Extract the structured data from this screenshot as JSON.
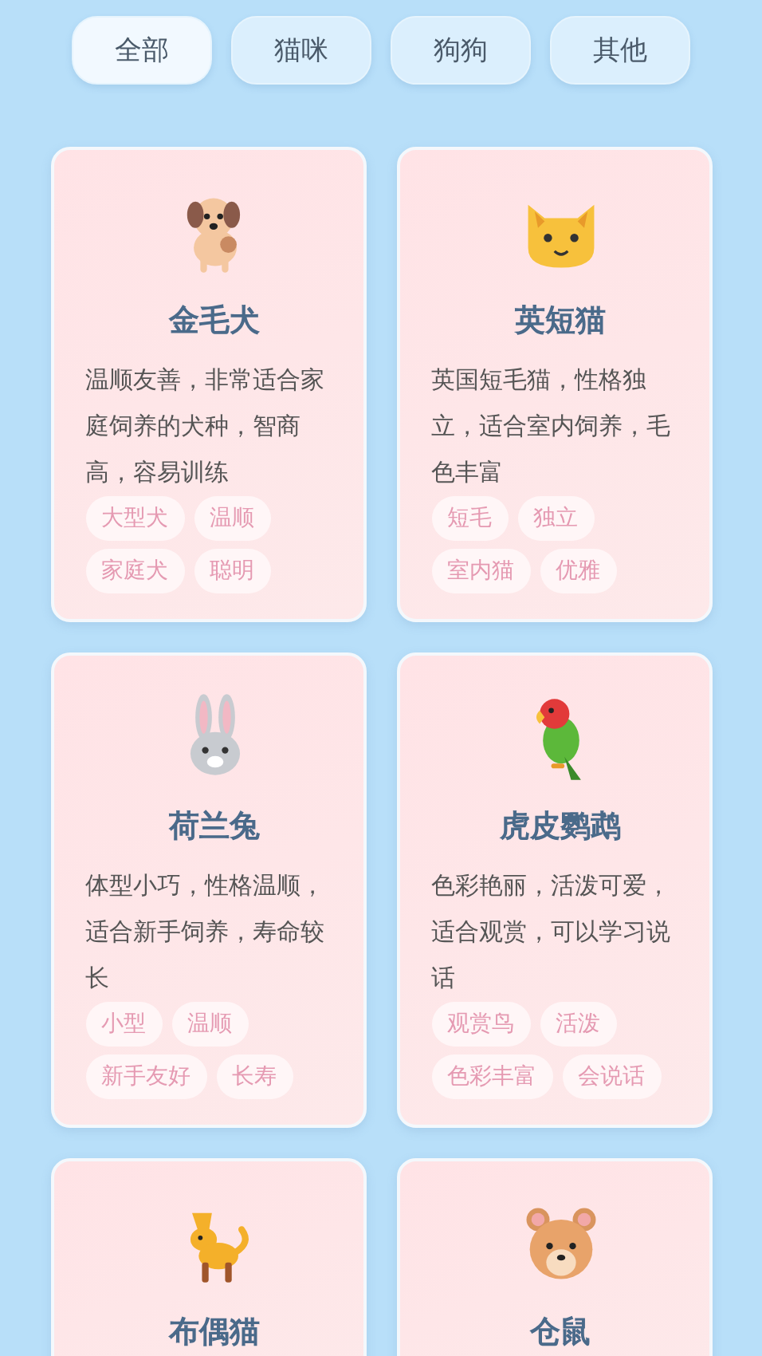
{
  "tabs": [
    {
      "label": "全部",
      "selected": true
    },
    {
      "label": "猫咪",
      "selected": false
    },
    {
      "label": "狗狗",
      "selected": false
    },
    {
      "label": "其他",
      "selected": false
    }
  ],
  "pets": [
    {
      "name": "金毛犬",
      "description": "温顺友善，非常适合家庭饲养的犬种，智商高，容易训练",
      "tags": [
        "大型犬",
        "温顺",
        "家庭犬",
        "聪明"
      ]
    },
    {
      "name": "英短猫",
      "description": "英国短毛猫，性格独立，适合室内饲养，毛色丰富",
      "tags": [
        "短毛",
        "独立",
        "室内猫",
        "优雅"
      ]
    },
    {
      "name": "荷兰兔",
      "description": "体型小巧，性格温顺，适合新手饲养，寿命较长",
      "tags": [
        "小型",
        "温顺",
        "新手友好",
        "长寿"
      ]
    },
    {
      "name": "虎皮鹦鹉",
      "description": "色彩艳丽，活泼可爱，适合观赏，可以学习说话",
      "tags": [
        "观赏鸟",
        "活泼",
        "色彩丰富",
        "会说话"
      ]
    },
    {
      "name": "布偶猫"
    },
    {
      "name": "仓鼠"
    }
  ]
}
